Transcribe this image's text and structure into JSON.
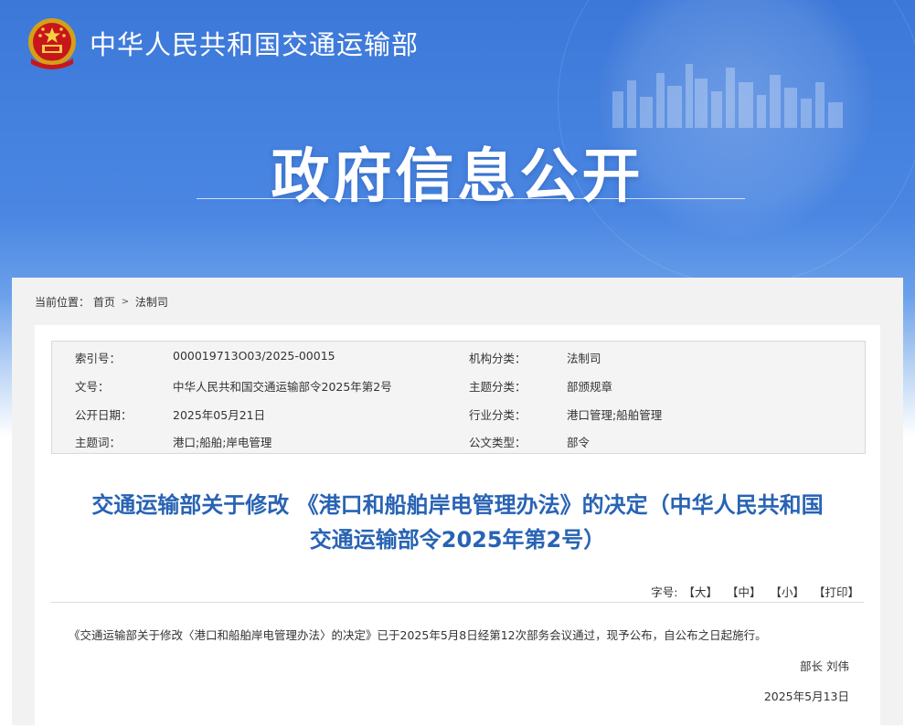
{
  "header": {
    "ministry_name": "中华人民共和国交通运输部",
    "page_title": "政府信息公开",
    "emblem_icon": "national-emblem-icon"
  },
  "breadcrumb": {
    "label": "当前位置：",
    "home": "首页",
    "separator": ">",
    "current": "法制司"
  },
  "meta": {
    "rows": [
      {
        "k1": "索引号：",
        "v1": "000019713O03/2025-00015",
        "k2": "机构分类：",
        "v2": "法制司"
      },
      {
        "k1": "文号：",
        "v1": "中华人民共和国交通运输部令2025年第2号",
        "k2": "主题分类：",
        "v2": "部颁规章"
      },
      {
        "k1": "公开日期：",
        "v1": "2025年05月21日",
        "k2": "行业分类：",
        "v2": "港口管理;船舶管理"
      },
      {
        "k1": "主题词：",
        "v1": "港口;船舶;岸电管理",
        "k2": "公文类型：",
        "v2": "部令"
      }
    ]
  },
  "document": {
    "title_line1": "交通运输部关于修改 《港口和船舶岸电管理办法》的决定（中华人民共和国",
    "title_line2": "交通运输部令2025年第2号）",
    "body": "《交通运输部关于修改〈港口和船舶岸电管理办法〉的决定》已于2025年5月8日经第12次部务会议通过，现予公布，自公布之日起施行。",
    "signer": "部长 刘伟",
    "date": "2025年5月13日"
  },
  "font_size_controls": {
    "label": "字号:",
    "large": "【大】",
    "medium": "【中】",
    "small": "【小】",
    "print": "【打印】"
  },
  "colors": {
    "banner_blue": "#3c78d8",
    "title_blue": "#2863b4",
    "panel_gray": "#f2f2f2"
  }
}
